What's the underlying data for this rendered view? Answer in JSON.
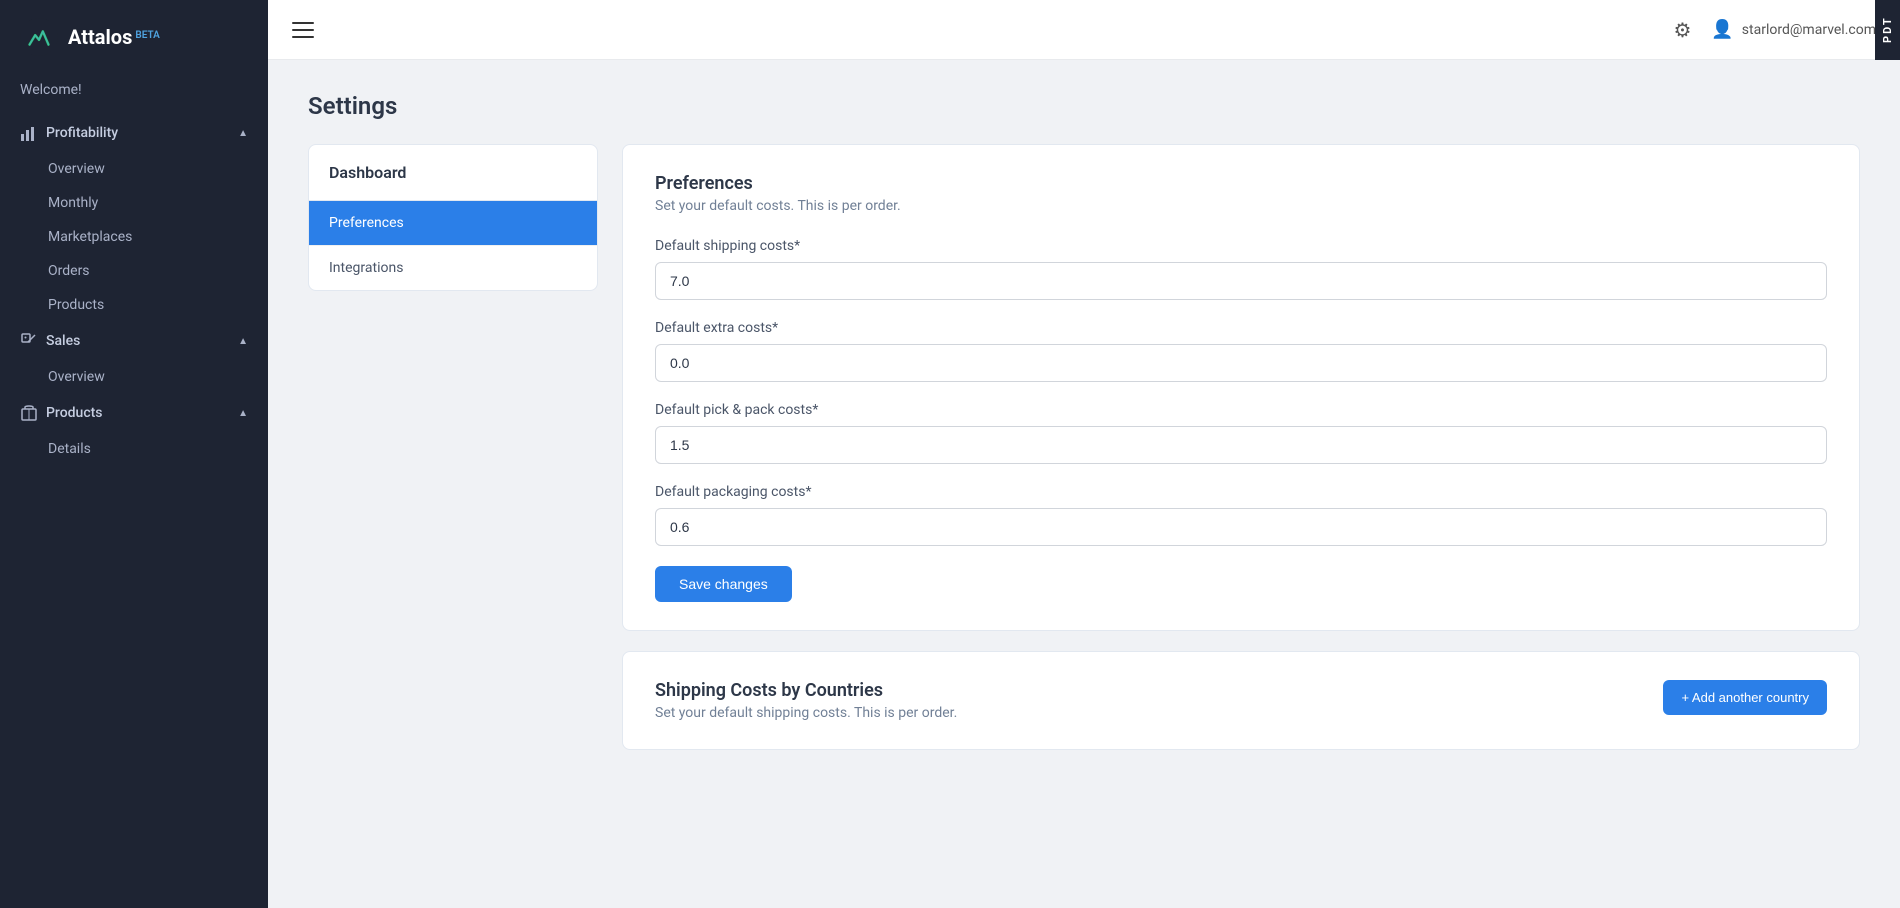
{
  "app": {
    "name": "Attalos",
    "beta": "BETA",
    "pdt": "PDT"
  },
  "sidebar": {
    "welcome": "Welcome!",
    "sections": [
      {
        "id": "profitability",
        "label": "Profitability",
        "icon": "bar-chart-icon",
        "expanded": true,
        "items": [
          {
            "id": "overview",
            "label": "Overview"
          },
          {
            "id": "monthly",
            "label": "Monthly"
          },
          {
            "id": "marketplaces",
            "label": "Marketplaces"
          },
          {
            "id": "orders",
            "label": "Orders"
          },
          {
            "id": "products",
            "label": "Products"
          }
        ]
      },
      {
        "id": "sales",
        "label": "Sales",
        "icon": "tag-icon",
        "expanded": true,
        "items": [
          {
            "id": "sales-overview",
            "label": "Overview"
          }
        ]
      },
      {
        "id": "products",
        "label": "Products",
        "icon": "box-icon",
        "expanded": true,
        "items": [
          {
            "id": "details",
            "label": "Details"
          }
        ]
      }
    ]
  },
  "topbar": {
    "user_email": "starlord@marvel.com",
    "gear_label": "Settings",
    "hamburger_label": "Menu"
  },
  "page": {
    "title": "Settings"
  },
  "left_panel": {
    "header": "Dashboard",
    "items": [
      {
        "id": "preferences",
        "label": "Preferences",
        "active": true
      },
      {
        "id": "integrations",
        "label": "Integrations",
        "active": false
      }
    ]
  },
  "preferences": {
    "title": "Preferences",
    "subtitle": "Set your default costs. This is per order.",
    "fields": [
      {
        "id": "default_shipping",
        "label": "Default shipping costs*",
        "value": "7.0"
      },
      {
        "id": "default_extra",
        "label": "Default extra costs*",
        "value": "0.0"
      },
      {
        "id": "default_pick_pack",
        "label": "Default pick & pack costs*",
        "value": "1.5"
      },
      {
        "id": "default_packaging",
        "label": "Default packaging costs*",
        "value": "0.6"
      }
    ],
    "save_button": "Save changes"
  },
  "shipping_countries": {
    "title": "Shipping Costs by Countries",
    "subtitle": "Set your default shipping costs. This is per order.",
    "add_button": "+ Add another country"
  }
}
